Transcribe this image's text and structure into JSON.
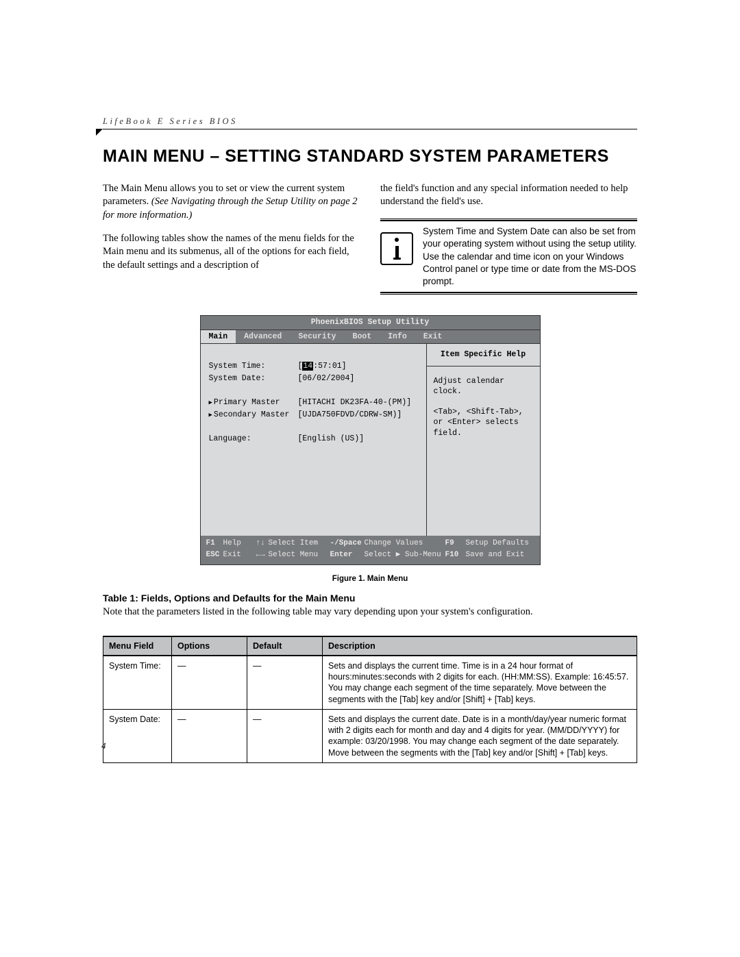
{
  "header": {
    "running": "LifeBook E Series BIOS"
  },
  "title": "MAIN MENU – SETTING STANDARD SYSTEM PARAMETERS",
  "body": {
    "p1a": "The Main Menu allows you to set or view the current system parameters. ",
    "p1b": "(See Navigating through the Setup Utility on page 2 for more information.)",
    "p2": "The following tables show the names of the menu fields for the Main menu and its submenus, all of the options for each field, the default settings and a description of",
    "p3": "the field's function and any special information needed to help understand the field's use.",
    "note": "System Time and System Date can also be set from your operating system without using the setup utility. Use the calendar and time icon on your Windows Control panel or type time or date from the MS-DOS prompt."
  },
  "bios": {
    "title": "PhoenixBIOS Setup Utility",
    "menus": [
      "Main",
      "Advanced",
      "Security",
      "Boot",
      "Info",
      "Exit"
    ],
    "active_menu": 0,
    "fields": {
      "time_label": "System Time:",
      "time_hh": "14",
      "time_rest": ":57:01]",
      "date_label": "System Date:",
      "date_value": "[06/02/2004]",
      "pm_label": "Primary Master",
      "pm_value": "[HITACHI DK23FA-40-(PM)]",
      "sm_label": "Secondary Master",
      "sm_value": "[UJDA750FDVD/CDRW-SM)]",
      "lang_label": "Language:",
      "lang_value": "[English (US)]"
    },
    "help": {
      "title": "Item Specific Help",
      "l1": "Adjust calendar clock.",
      "l2": "<Tab>, <Shift-Tab>, or <Enter> selects field."
    },
    "footer": {
      "f1": "F1",
      "help": "Help",
      "updown": "↑↓",
      "select_item": "Select Item",
      "minus": "-/Space",
      "change": "Change Values",
      "f9": "F9",
      "setup_def": "Setup Defaults",
      "esc": "ESC",
      "exit": "Exit",
      "lr": "←→",
      "select_menu": "Select Menu",
      "enter": "Enter",
      "submenu": "Select ▶ Sub-Menu",
      "f10": "F10",
      "save": "Save and Exit"
    }
  },
  "figure_caption": "Figure 1.  Main Menu",
  "table": {
    "title": "Table 1: Fields, Options and Defaults for the Main Menu",
    "note": "Note that the parameters listed in the following table may vary depending upon your system's configuration.",
    "headers": [
      "Menu Field",
      "Options",
      "Default",
      "Description"
    ],
    "rows": [
      {
        "field": "System Time:",
        "options": "—",
        "default": "—",
        "desc": "Sets and displays the current time. Time is in a 24 hour format of hours:minutes:seconds with 2 digits for each. (HH:MM:SS). Example: 16:45:57. You may change each segment of the time separately. Move between the segments with the [Tab] key and/or [Shift] + [Tab] keys."
      },
      {
        "field": "System Date:",
        "options": "—",
        "default": "—",
        "desc": "Sets and displays the current date. Date is in a month/day/year numeric format with 2 digits each for month and day and 4 digits for year. (MM/DD/YYYY) for example: 03/20/1998. You may change each segment of the date separately. Move between the segments with the [Tab] key and/or [Shift] + [Tab] keys."
      }
    ]
  },
  "page_number": "4"
}
